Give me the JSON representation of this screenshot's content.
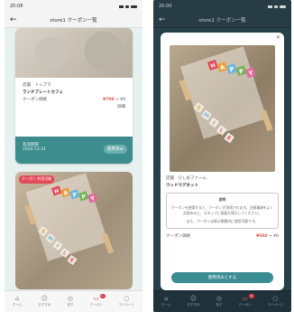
{
  "left": {
    "status": {
      "time": "20:08"
    },
    "nav": {
      "title": "store1 クーポン一覧"
    },
    "card1": {
      "shop_label": "店舗",
      "shop_name": "トップマ",
      "item_name": "ランチプレートカフェ",
      "price_label": "クーポン価格",
      "price_old": "¥700",
      "price_new": "¥0",
      "more": "詳細",
      "valid_label": "有効期限",
      "valid_date": "2024-12-31",
      "use_button": "使用済み"
    },
    "card2": {
      "badge": "クーポン 利用可能"
    }
  },
  "right": {
    "status": {
      "time": "20:00"
    },
    "nav": {
      "title": "store1 クーポン一覧"
    },
    "modal": {
      "shop_label": "店舗",
      "shop_name": "ひしおファーム",
      "item_name": "ウッドマグネット",
      "notice_title": "説明",
      "notice_text": "クーポンを使用すると、クーポンが消費されます。注意事項をよくお読みの上、スタッフに画面を提示してください。",
      "notice_sub": "また、クーポンは表示期限内に使用可能です。",
      "price_label": "クーポン価格",
      "price_old": "¥500",
      "price_new": "¥0",
      "use_button": "使用済みとする"
    }
  },
  "tabs": [
    {
      "label": "ホーム",
      "icon": "home-icon"
    },
    {
      "label": "おすすめ",
      "icon": "people-icon"
    },
    {
      "label": "探す",
      "icon": "camera-icon"
    },
    {
      "label": "クーポン",
      "icon": "coupon-icon",
      "active": true,
      "badge": "1"
    },
    {
      "label": "マイページ",
      "icon": "user-icon"
    }
  ],
  "blocks": {
    "letters_happy": "HAPPY",
    "letters_smile": "SMILE",
    "colors": [
      "#e2475a",
      "#e9a23f",
      "#6fb5d9",
      "#77b25a",
      "#e06b9b"
    ]
  }
}
